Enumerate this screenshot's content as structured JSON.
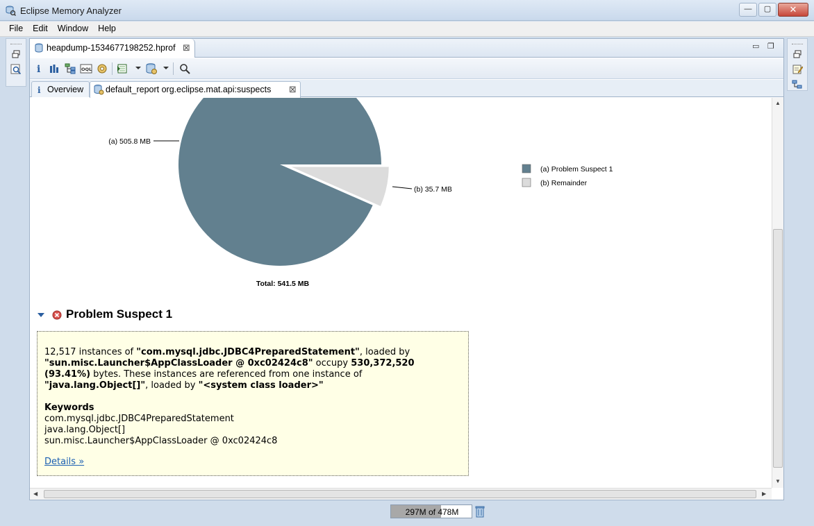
{
  "window": {
    "title": "Eclipse Memory Analyzer",
    "minimize": "—",
    "maximize": "▢",
    "close": "✕"
  },
  "menu": [
    "File",
    "Edit",
    "Window",
    "Help"
  ],
  "editor": {
    "tab_label": "heapdump-1534677198252.hprof",
    "subtabs": {
      "overview": "Overview",
      "report": "default_report  org.eclipse.mat.api:suspects"
    }
  },
  "chart_data": {
    "type": "pie",
    "slices": [
      {
        "key": "(a)",
        "label": "Problem Suspect 1",
        "value": 505.8,
        "display": "505.8 MB",
        "color": "#62808f"
      },
      {
        "key": "(b)",
        "label": "Remainder",
        "value": 35.7,
        "display": "35.7 MB",
        "color": "#dcdcdc"
      }
    ],
    "total": "Total: 541.5 MB",
    "legend_position": "right"
  },
  "suspect": {
    "title": "Problem Suspect 1",
    "text": {
      "p1": "12,517 instances of ",
      "class1": "\"com.mysql.jdbc.JDBC4PreparedStatement\"",
      "p2": ", loaded by ",
      "loader1": "\"sun.misc.Launcher$AppClassLoader @ 0xc02424c8\"",
      "p3": " occupy ",
      "bytes": "530,372,520 (93.41%)",
      "p4": " bytes. These instances are referenced from one instance of ",
      "class2": "\"java.lang.Object[]\"",
      "p5": ", loaded by ",
      "loader2": "\"<system class loader>\""
    },
    "keywords_title": "Keywords",
    "keywords": [
      "com.mysql.jdbc.JDBC4PreparedStatement",
      "java.lang.Object[]",
      "sun.misc.Launcher$AppClassLoader @ 0xc02424c8"
    ],
    "details_link": "Details »"
  },
  "status": {
    "heap_text": "297M of 478M",
    "heap_used_fraction": 0.62
  }
}
